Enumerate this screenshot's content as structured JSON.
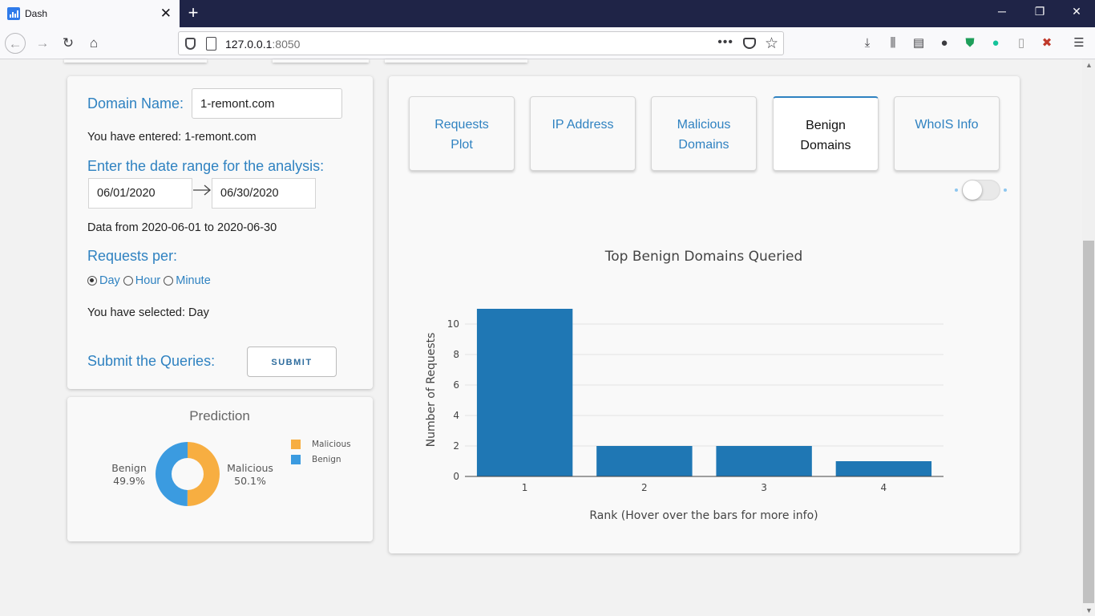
{
  "browser": {
    "tab_title": "Dash",
    "url_host": "127.0.0.1",
    "url_port": ":8050"
  },
  "form": {
    "domain_label": "Domain Name:",
    "domain_value": "1-remont.com",
    "entered_text": "You have entered: 1-remont.com",
    "date_label": "Enter the date range for the analysis:",
    "start_date": "06/01/2020",
    "end_date": "06/30/2020",
    "data_range_text": "Data from 2020-06-01 to 2020-06-30",
    "requests_label": "Requests per:",
    "radio_options": [
      "Day",
      "Hour",
      "Minute"
    ],
    "radio_selected": "Day",
    "selected_text": "You have selected: Day",
    "submit_label": "Submit the Queries:",
    "submit_button": "SUBMIT"
  },
  "prediction": {
    "title": "Prediction",
    "slices": [
      {
        "name": "Malicious",
        "percent": 50.1,
        "color": "#f7ae41",
        "label": "Malicious",
        "pct_text": "50.1%"
      },
      {
        "name": "Benign",
        "percent": 49.9,
        "color": "#3b9be0",
        "label": "Benign",
        "pct_text": "49.9%"
      }
    ],
    "legend": [
      "Malicious",
      "Benign"
    ]
  },
  "tabs": [
    {
      "line1": "Requests",
      "line2": "Plot"
    },
    {
      "line1": "IP Address",
      "line2": ""
    },
    {
      "line1": "Malicious",
      "line2": "Domains"
    },
    {
      "line1": "Benign",
      "line2": "Domains"
    },
    {
      "line1": "WhoIS Info",
      "line2": ""
    }
  ],
  "active_tab": 3,
  "colors": {
    "accent": "#2f82c1",
    "bar": "#1f77b4",
    "toggle_dot": "#8ec7ef"
  },
  "chart_data": {
    "type": "bar",
    "title": "Top Benign Domains Queried",
    "xlabel": "Rank (Hover over the bars for more info)",
    "ylabel": "Number of Requests",
    "categories": [
      "1",
      "2",
      "3",
      "4"
    ],
    "values": [
      11,
      2,
      2,
      1
    ],
    "ylim": [
      0,
      11
    ],
    "yticks": [
      0,
      2,
      4,
      6,
      8,
      10
    ],
    "grid": true
  }
}
